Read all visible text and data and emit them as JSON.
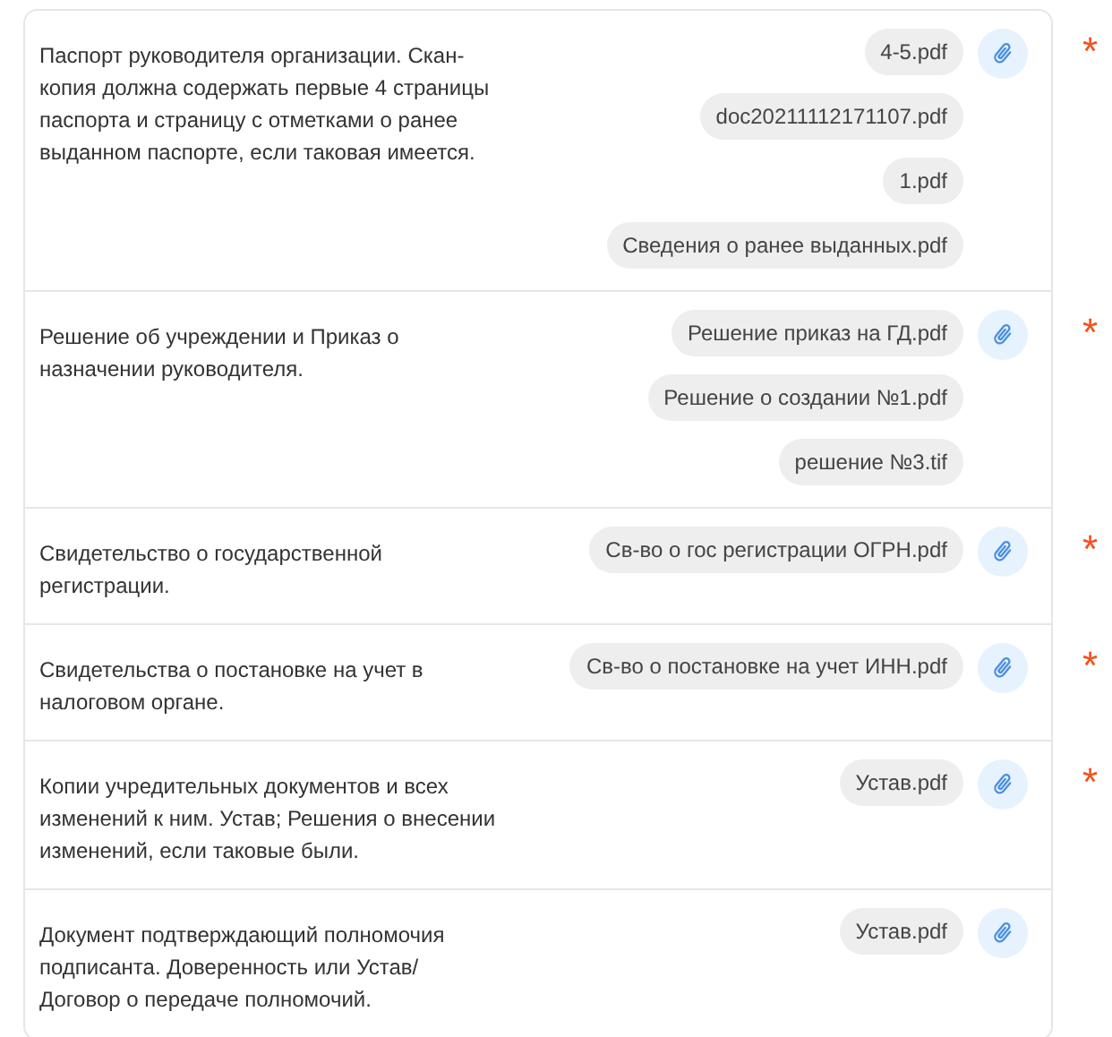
{
  "documents": [
    {
      "description": "Паспорт руководителя организации. Скан-копия должна содержать первые 4 страницы паспорта и страницу с отметками о ранее выданном паспорте, если таковая имеется.",
      "files": [
        "4-5.pdf",
        "doc20211112171107.pdf",
        "1.pdf",
        "Сведения о ранее выданных.pdf"
      ],
      "required_mark": "*"
    },
    {
      "description": "Решение об учреждении и Приказ о назначении руководителя.",
      "files": [
        "Решение приказ на ГД.pdf",
        "Решение о создании №1.pdf",
        "решение №3.tif"
      ],
      "required_mark": "*"
    },
    {
      "description": "Свидетельство о государственной регистрации.",
      "files": [
        "Св-во о гос регистрации ОГРН.pdf"
      ],
      "required_mark": "*"
    },
    {
      "description": "Свидетельства о постановке на учет в налоговом органе.",
      "files": [
        "Св-во о постановке на учет ИНН.pdf"
      ],
      "required_mark": "*"
    },
    {
      "description": "Копии учредительных документов и всех изменений к ним. Устав; Решения о внесении изменений, если таковые были.",
      "files": [
        "Устав.pdf"
      ],
      "required_mark": "*"
    },
    {
      "description": "Документ подтверждающий полномочия подписанта. Доверенность или Устав/ Договор о передаче полномочий.",
      "files": [
        "Устав.pdf"
      ]
    }
  ]
}
